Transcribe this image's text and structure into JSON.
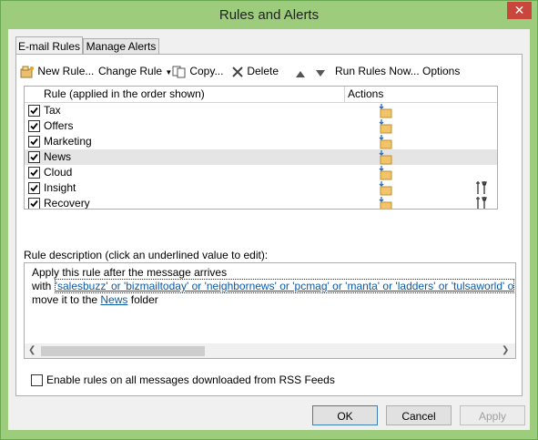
{
  "window": {
    "title": "Rules and Alerts",
    "close_glyph": "✕"
  },
  "tabs": [
    {
      "label": "E-mail Rules",
      "active": true
    },
    {
      "label": "Manage Alerts",
      "active": false
    }
  ],
  "toolbar": {
    "new_rule": "New Rule...",
    "change_rule": "Change Rule",
    "copy": "Copy...",
    "delete": "Delete",
    "run_rules_now": "Run Rules Now...",
    "options": "Options"
  },
  "rules_list": {
    "col_rule": "Rule (applied in the order shown)",
    "col_actions": "Actions",
    "rows": [
      {
        "name": "Tax",
        "checked": true,
        "selected": false
      },
      {
        "name": "Offers",
        "checked": true,
        "selected": false
      },
      {
        "name": "Marketing",
        "checked": true,
        "selected": false
      },
      {
        "name": "News",
        "checked": true,
        "selected": true
      },
      {
        "name": "Cloud",
        "checked": true,
        "selected": false
      },
      {
        "name": "Insight",
        "checked": true,
        "selected": false
      },
      {
        "name": "Recovery",
        "checked": true,
        "selected": false
      }
    ]
  },
  "description": {
    "label": "Rule description (click an underlined value to edit):",
    "line1": "Apply this rule after the message arrives",
    "line2_prefix": "with",
    "line2_value": "'salesbuzz' or 'bizmailtoday' or 'neighbornews' or 'pcmag' or 'manta' or 'ladders' or 'tulsaworld' o",
    "line3_prefix": "move it to the",
    "line3_folder": "News",
    "line3_suffix": "folder"
  },
  "rss_option": {
    "label": "Enable rules on all messages downloaded from RSS Feeds",
    "checked": false
  },
  "buttons": {
    "ok": "OK",
    "cancel": "Cancel",
    "apply": "Apply"
  }
}
